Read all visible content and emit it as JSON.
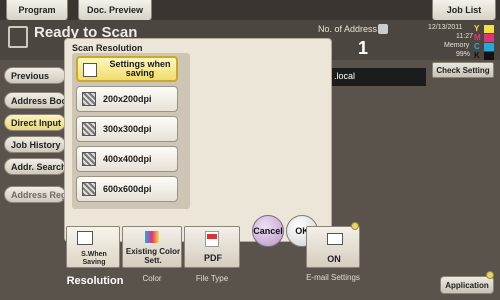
{
  "top_tabs": {
    "program": "Program",
    "doc_preview": "Doc. Preview",
    "job_list": "Job List"
  },
  "header": {
    "status_title": "Ready to Scan",
    "no_of_address_label": "No. of Address",
    "no_of_address_value": "1",
    "date": "12/13/2011",
    "time": "11:27",
    "memory_label": "Memory",
    "memory_value": "99%",
    "toner": [
      "Y",
      "M",
      "C",
      "K"
    ]
  },
  "left_nav": {
    "previous": "Previous",
    "address_book": "Address Book",
    "direct_input": "Direct Input",
    "job_history": "Job History",
    "addr_search": "Addr. Search",
    "address_reg": "Address Reg."
  },
  "address_field_value": ".local",
  "check_setting": "Check Setting",
  "dialog": {
    "title": "Scan Resolution",
    "options": [
      {
        "label": "Settings when saving",
        "selected": true
      },
      {
        "label": "200x200dpi"
      },
      {
        "label": "300x300dpi"
      },
      {
        "label": "400x400dpi"
      },
      {
        "label": "600x600dpi"
      }
    ],
    "cancel": "Cancel",
    "ok": "OK"
  },
  "function_buttons": [
    {
      "text": "S.When Saving",
      "caption": "Resolution"
    },
    {
      "text": "Existing Color Sett.",
      "caption": "Color"
    },
    {
      "text": "PDF",
      "caption": "File Type"
    },
    {
      "text": "ON",
      "caption": "E-mail Settings"
    }
  ],
  "application": "Application"
}
